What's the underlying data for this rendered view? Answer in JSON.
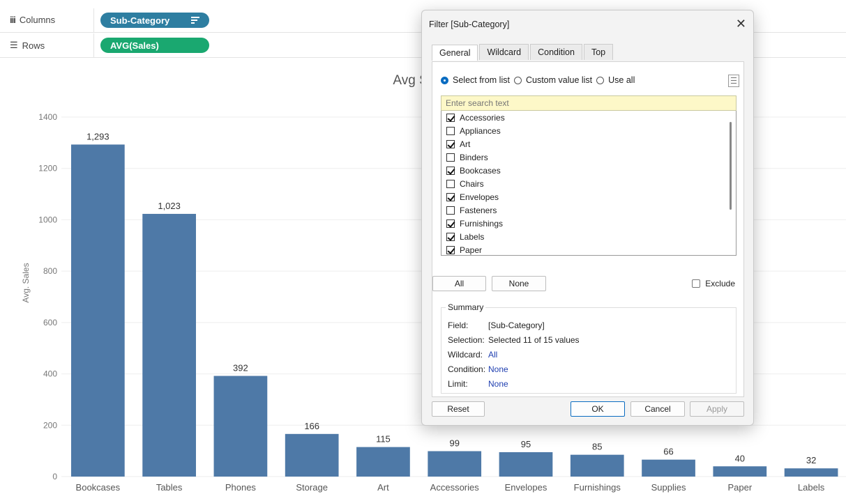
{
  "shelves": {
    "columns_label": "Columns",
    "columns_pill": "Sub-Category",
    "rows_label": "Rows",
    "rows_pill": "AVG(Sales)"
  },
  "colors": {
    "bar": "#4e79a7",
    "dimension_pill": "#2e7ea1",
    "measure_pill": "#1aa870"
  },
  "chart_data": {
    "type": "bar",
    "title": "Avg Sales",
    "xlabel": "",
    "ylabel": "Avg. Sales",
    "ylim": [
      0,
      1400
    ],
    "yticks": [
      0,
      200,
      400,
      600,
      800,
      1000,
      1200,
      1400
    ],
    "categories": [
      "Bookcases",
      "Tables",
      "Phones",
      "Storage",
      "Art",
      "Accessories",
      "Envelopes",
      "Furnishings",
      "Supplies",
      "Paper",
      "Labels"
    ],
    "values": [
      1293,
      1023,
      392,
      166,
      115,
      99,
      95,
      85,
      66,
      40,
      32
    ],
    "labels": [
      "1,293",
      "1,023",
      "392",
      "166",
      "115",
      "99",
      "95",
      "85",
      "66",
      "40",
      "32"
    ],
    "grid": true
  },
  "dialog": {
    "title": "Filter [Sub-Category]",
    "tabs": [
      "General",
      "Wildcard",
      "Condition",
      "Top"
    ],
    "radio_select_from_list": "Select from list",
    "radio_custom_value_list": "Custom value list",
    "radio_use_all": "Use all",
    "search_placeholder": "Enter search text",
    "items": [
      {
        "label": "Accessories",
        "checked": true
      },
      {
        "label": "Appliances",
        "checked": false
      },
      {
        "label": "Art",
        "checked": true
      },
      {
        "label": "Binders",
        "checked": false
      },
      {
        "label": "Bookcases",
        "checked": true
      },
      {
        "label": "Chairs",
        "checked": false
      },
      {
        "label": "Envelopes",
        "checked": true
      },
      {
        "label": "Fasteners",
        "checked": false
      },
      {
        "label": "Furnishings",
        "checked": true
      },
      {
        "label": "Labels",
        "checked": true
      },
      {
        "label": "Paper",
        "checked": true
      }
    ],
    "all_button": "All",
    "none_button": "None",
    "exclude_label": "Exclude",
    "summary": {
      "title": "Summary",
      "field_key": "Field:",
      "field_val": "[Sub-Category]",
      "selection_key": "Selection:",
      "selection_val": "Selected 11 of 15 values",
      "wildcard_key": "Wildcard:",
      "wildcard_val": "All",
      "condition_key": "Condition:",
      "condition_val": "None",
      "limit_key": "Limit:",
      "limit_val": "None"
    },
    "reset_button": "Reset",
    "ok_button": "OK",
    "cancel_button": "Cancel",
    "apply_button": "Apply"
  }
}
